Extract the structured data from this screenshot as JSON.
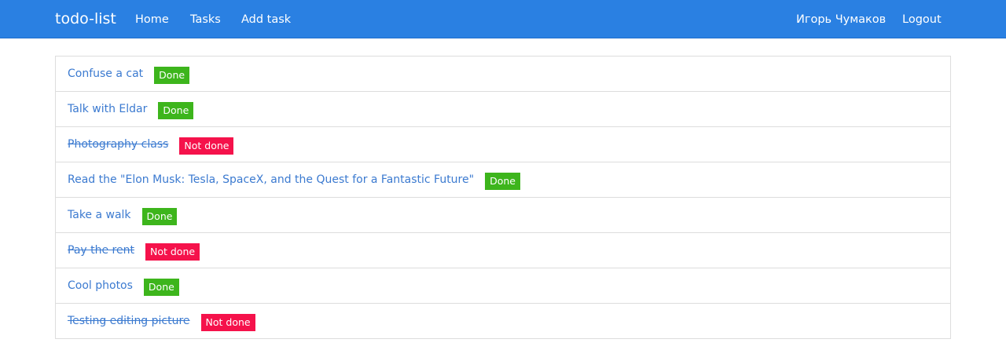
{
  "navbar": {
    "brand": "todo-list",
    "links": {
      "home": "Home",
      "tasks": "Tasks",
      "add_task": "Add task"
    },
    "user": "Игорь Чумаков",
    "logout": "Logout",
    "colors": {
      "background": "#2a80e2",
      "text": "#ffffff"
    }
  },
  "tasks": [
    {
      "title": "Confuse a cat",
      "status": "Done",
      "done": true
    },
    {
      "title": "Talk with Eldar",
      "status": "Done",
      "done": true
    },
    {
      "title": "Photography class ",
      "status": "Not done",
      "done": false
    },
    {
      "title": "Read the \"Elon Musk: Tesla, SpaceX, and the Quest for a Fantastic Future\"",
      "status": "Done",
      "done": true
    },
    {
      "title": "Take a walk",
      "status": "Done",
      "done": true
    },
    {
      "title": "Pay the rent ",
      "status": "Not done",
      "done": false
    },
    {
      "title": "Cool photos",
      "status": "Done",
      "done": true
    },
    {
      "title": "Testing editing picture ",
      "status": "Not done",
      "done": false
    }
  ],
  "colors": {
    "link": "#3b7ad0",
    "done_badge": "#3db51c",
    "not_done_badge": "#f5124b",
    "border": "#dddddd"
  }
}
